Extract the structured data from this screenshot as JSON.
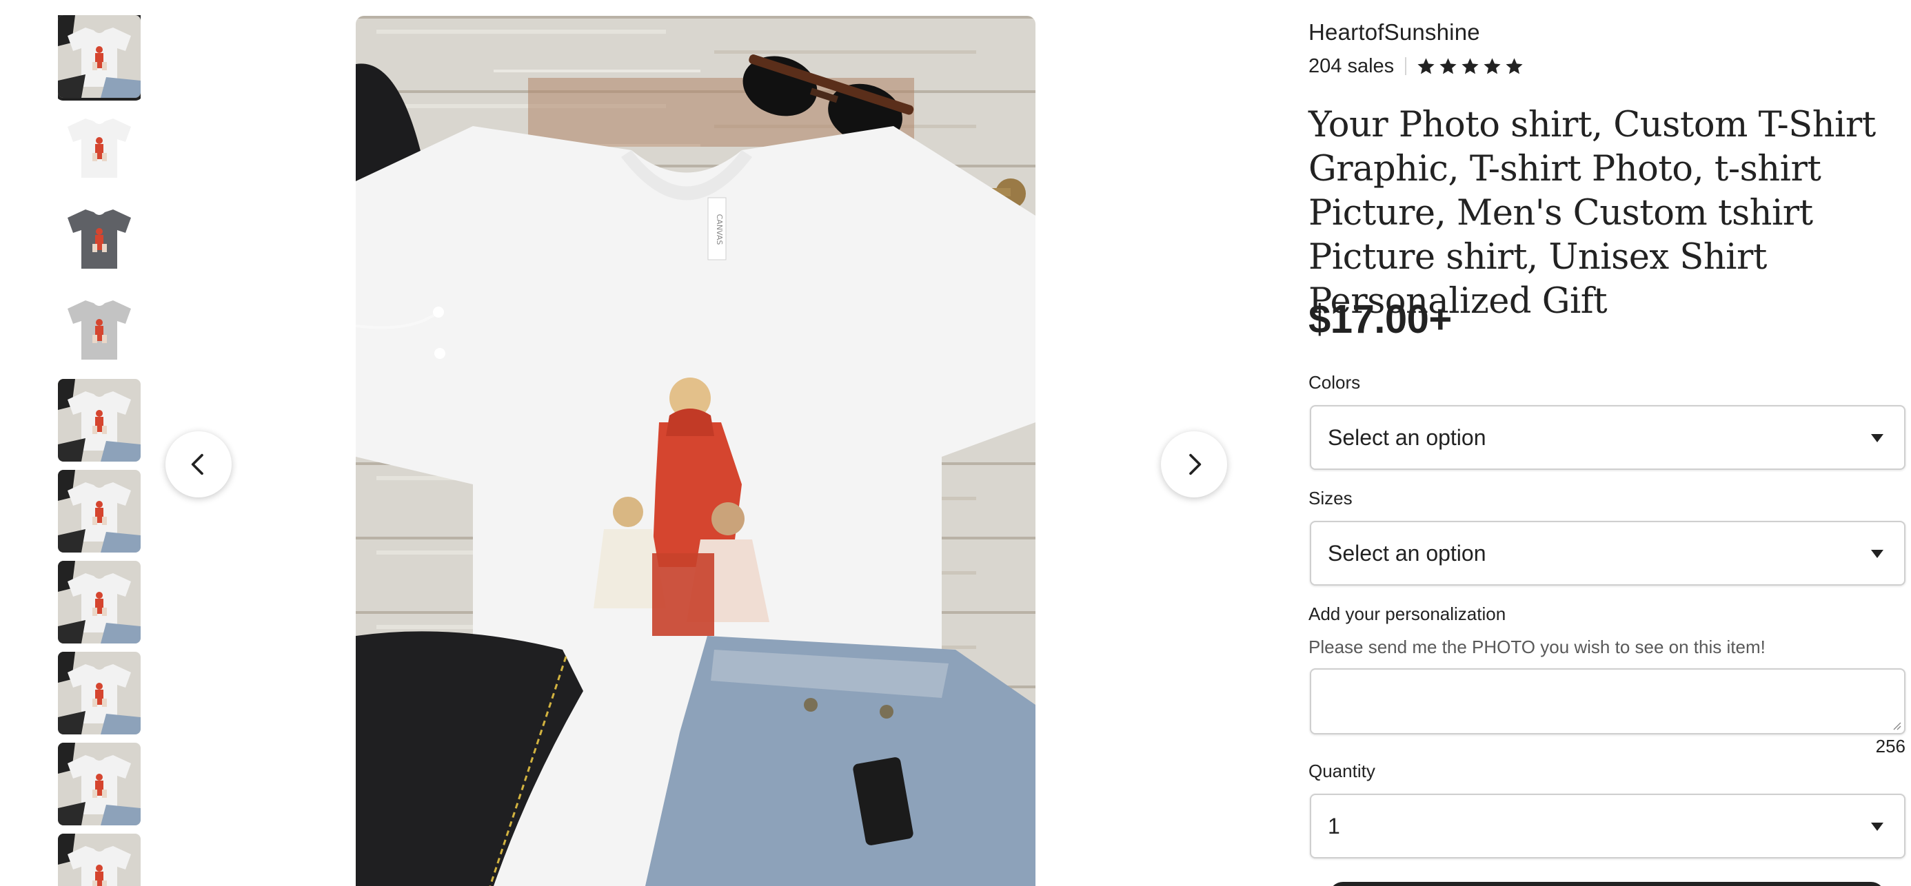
{
  "gallery": {
    "thumbnails": [
      {
        "variant": "white-scene",
        "active": true
      },
      {
        "variant": "white-plain"
      },
      {
        "variant": "dark-gray"
      },
      {
        "variant": "light-gray"
      },
      {
        "variant": "white-scene"
      },
      {
        "variant": "white-scene"
      },
      {
        "variant": "white-scene"
      },
      {
        "variant": "white-scene"
      },
      {
        "variant": "white-scene"
      },
      {
        "variant": "white-scene"
      }
    ],
    "prev_icon": "chevron-left-icon",
    "next_icon": "chevron-right-icon",
    "main_image_alt": "white t-shirt with photo print",
    "tag_text": "CANVAS"
  },
  "shop": {
    "name": "HeartofSunshine",
    "sales": "204 sales",
    "rating": 5,
    "rating_max": 5,
    "star_icon": "star-icon"
  },
  "product": {
    "title": "Your Photo shirt, Custom T-Shirt Graphic, T-shirt Photo, t-shirt Picture, Men's Custom tshirt Picture shirt, Unisex Shirt Personalized Gift",
    "price": "$17.00+"
  },
  "options": {
    "colors_label": "Colors",
    "colors_value": "Select an option",
    "sizes_label": "Sizes",
    "sizes_value": "Select an option",
    "personalization_label": "Add your personalization",
    "personalization_help": "Please send me the PHOTO you wish to see on this item!",
    "personalization_value": "",
    "char_remaining": "256",
    "quantity_label": "Quantity",
    "quantity_value": "1"
  },
  "colors": {
    "text": "#222222",
    "muted": "#595959",
    "border": "#cfcfcf",
    "button": "#222222"
  }
}
